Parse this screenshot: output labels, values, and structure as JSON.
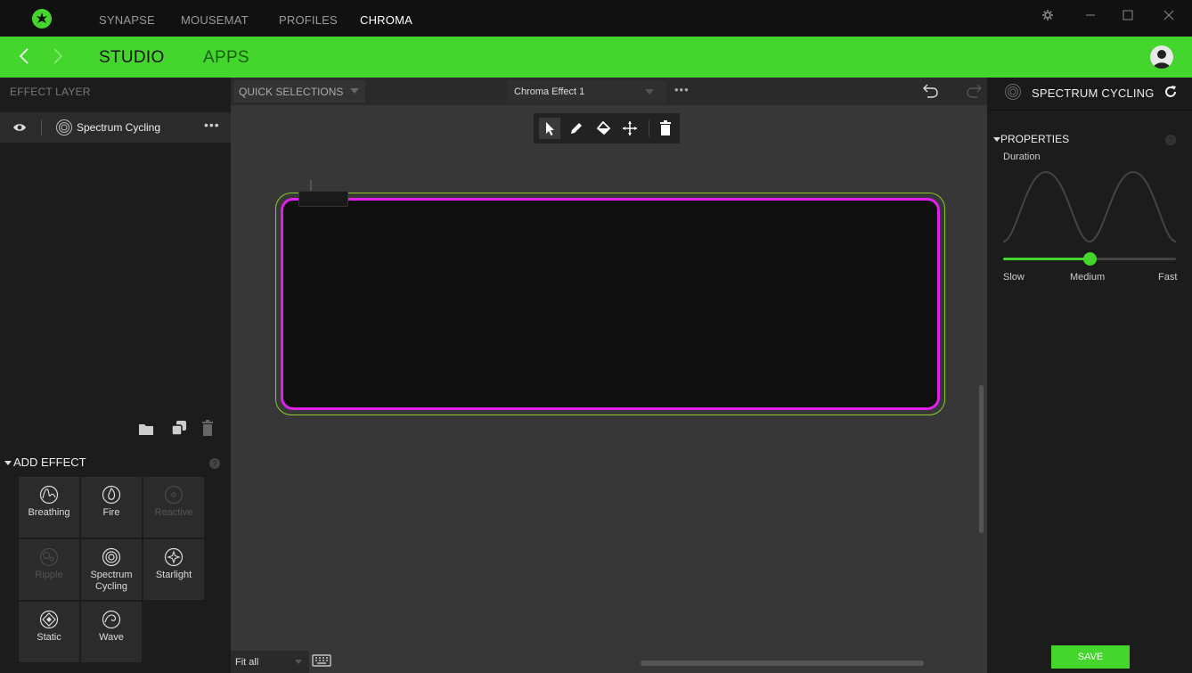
{
  "titlebar": {
    "tabs": [
      "SYNAPSE",
      "MOUSEMAT",
      "PROFILES",
      "CHROMA"
    ],
    "active_tab": "CHROMA"
  },
  "subbar": {
    "tabs": [
      "STUDIO",
      "APPS"
    ],
    "active_tab": "STUDIO"
  },
  "left_panel": {
    "header": "EFFECT LAYER",
    "layers": [
      {
        "label": "Spectrum Cycling",
        "icon": "spectrum-cycling-icon"
      }
    ],
    "add_effect": {
      "title": "ADD EFFECT",
      "effects": [
        {
          "label": "Breathing",
          "icon": "breathing-icon",
          "enabled": true
        },
        {
          "label": "Fire",
          "icon": "fire-icon",
          "enabled": true
        },
        {
          "label": "Reactive",
          "icon": "reactive-icon",
          "enabled": false
        },
        {
          "label": "Ripple",
          "icon": "ripple-icon",
          "enabled": false
        },
        {
          "label": "Spectrum\nCycling",
          "icon": "spectrum-cycling-icon",
          "enabled": true
        },
        {
          "label": "Starlight",
          "icon": "starlight-icon",
          "enabled": true
        },
        {
          "label": "Static",
          "icon": "static-icon",
          "enabled": true
        },
        {
          "label": "Wave",
          "icon": "wave-icon",
          "enabled": true
        }
      ]
    }
  },
  "center": {
    "quick_selections": "QUICK SELECTIONS",
    "effect_name": "Chroma Effect 1",
    "zoom": "Fit all"
  },
  "right_panel": {
    "title": "SPECTRUM CYCLING",
    "properties_title": "PROPERTIES",
    "duration_label": "Duration",
    "slider": {
      "min_label": "Slow",
      "mid_label": "Medium",
      "max_label": "Fast",
      "value": 0.5
    },
    "save_label": "SAVE"
  },
  "colors": {
    "accent": "#44d62c",
    "mat_glow": "#e020e8"
  }
}
